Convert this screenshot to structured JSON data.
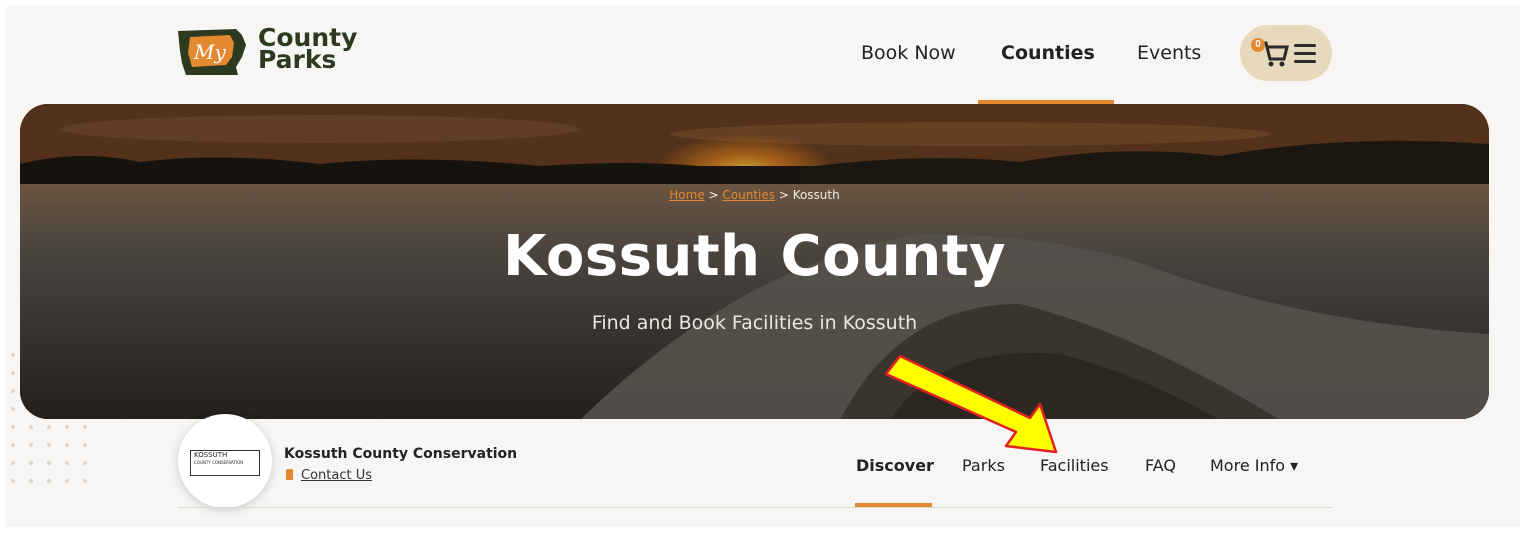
{
  "logo": {
    "text_line1": "County",
    "text_line2": "Parks",
    "badge": "My"
  },
  "nav": {
    "items": [
      {
        "label": "Book Now",
        "active": false
      },
      {
        "label": "Counties",
        "active": true
      },
      {
        "label": "Events",
        "active": false
      }
    ],
    "cart_count": "0"
  },
  "hero": {
    "breadcrumb": {
      "home": "Home",
      "sep1": " > ",
      "counties": "Counties",
      "sep2": " > ",
      "current": "Kossuth"
    },
    "title": "Kossuth County",
    "subtitle": "Find and Book Facilities in Kossuth"
  },
  "org": {
    "name": "Kossuth County Conservation",
    "contact_label": "Contact Us",
    "logo_text": "KOSSUTH",
    "logo_subtext": "COUNTY CONSERVATION"
  },
  "subnav": {
    "items": [
      {
        "label": "Discover",
        "active": true
      },
      {
        "label": "Parks",
        "active": false
      },
      {
        "label": "Facilities",
        "active": false
      },
      {
        "label": "FAQ",
        "active": false
      },
      {
        "label": "More Info ▾",
        "active": false
      }
    ]
  },
  "colors": {
    "accent": "#e4892f",
    "brand_dark": "#2e3a1f",
    "cart_bg": "#e8d9bd",
    "annotation_arrow": "#ffff00"
  }
}
